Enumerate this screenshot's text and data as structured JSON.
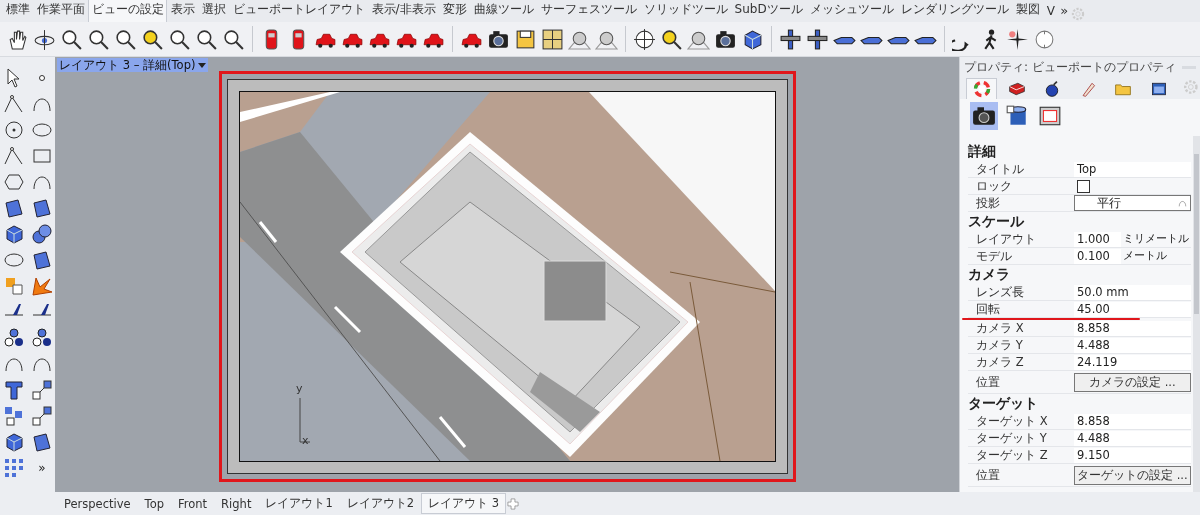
{
  "menu_tabs": [
    {
      "label": "標準",
      "selected": false
    },
    {
      "label": "作業平面",
      "selected": false
    },
    {
      "label": "ビューの設定",
      "selected": true
    },
    {
      "label": "表示",
      "selected": false
    },
    {
      "label": "選択",
      "selected": false
    },
    {
      "label": "ビューポートレイアウト",
      "selected": false
    },
    {
      "label": "表示/非表示",
      "selected": false
    },
    {
      "label": "変形",
      "selected": false
    },
    {
      "label": "曲線ツール",
      "selected": false
    },
    {
      "label": "サーフェスツール",
      "selected": false
    },
    {
      "label": "ソリッドツール",
      "selected": false
    },
    {
      "label": "SubDツール",
      "selected": false
    },
    {
      "label": "メッシュツール",
      "selected": false
    },
    {
      "label": "レンダリングツール",
      "selected": false
    },
    {
      "label": "製図",
      "selected": false
    },
    {
      "label": "V",
      "selected": false
    }
  ],
  "menu_overflow": "»",
  "left_toolbar": {
    "more": "»"
  },
  "viewport": {
    "title": "レイアウト 3 – 詳細(Top)",
    "axis_labels": [
      "y",
      "x"
    ]
  },
  "properties": {
    "title": "プロパティ: ビューポートのプロパティ",
    "tabs": [
      {
        "selected": true
      },
      {
        "selected": false
      },
      {
        "selected": false
      },
      {
        "selected": false
      },
      {
        "selected": false
      },
      {
        "selected": false
      }
    ],
    "views": [
      {
        "selected": true
      },
      {
        "selected": false
      },
      {
        "selected": false
      }
    ],
    "sections": [
      {
        "heading": "詳細",
        "rows": [
          {
            "kind": "text",
            "label": "タイトル",
            "value": "Top"
          },
          {
            "kind": "checkbox",
            "label": "ロック",
            "checked": false
          },
          {
            "kind": "dropdown",
            "label": "投影",
            "value": "平行"
          }
        ]
      },
      {
        "heading": "スケール",
        "rows": [
          {
            "kind": "unit",
            "label": "レイアウト",
            "value": "1.000",
            "unit": "ミリメートル"
          },
          {
            "kind": "unit",
            "label": "モデル",
            "value": "0.100",
            "unit": "メートル"
          }
        ]
      },
      {
        "heading": "カメラ",
        "rows": [
          {
            "kind": "text",
            "label": "レンズ長",
            "value": "50.0 mm"
          },
          {
            "kind": "text",
            "label": "回転",
            "value": "45.00"
          },
          {
            "kind": "text",
            "label": "カメラ X",
            "value": "8.858"
          },
          {
            "kind": "text",
            "label": "カメラ Y",
            "value": "4.488"
          },
          {
            "kind": "text",
            "label": "カメラ Z",
            "value": "24.119"
          },
          {
            "kind": "button",
            "label": "位置",
            "value": "カメラの設定 ..."
          }
        ]
      },
      {
        "heading": "ターゲット",
        "rows": [
          {
            "kind": "text",
            "label": "ターゲット X",
            "value": "8.858"
          },
          {
            "kind": "text",
            "label": "ターゲット Y",
            "value": "4.488"
          },
          {
            "kind": "text",
            "label": "ターゲット Z",
            "value": "9.150"
          },
          {
            "kind": "button",
            "label": "位置",
            "value": "ターゲットの設定 ..."
          }
        ]
      }
    ]
  },
  "layout_tabs": [
    {
      "label": "Perspective",
      "selected": false
    },
    {
      "label": "Top",
      "selected": false
    },
    {
      "label": "Front",
      "selected": false
    },
    {
      "label": "Right",
      "selected": false
    },
    {
      "label": "レイアウト1",
      "selected": false
    },
    {
      "label": "レイアウト2",
      "selected": false
    },
    {
      "label": "レイアウト 3",
      "selected": true
    }
  ]
}
